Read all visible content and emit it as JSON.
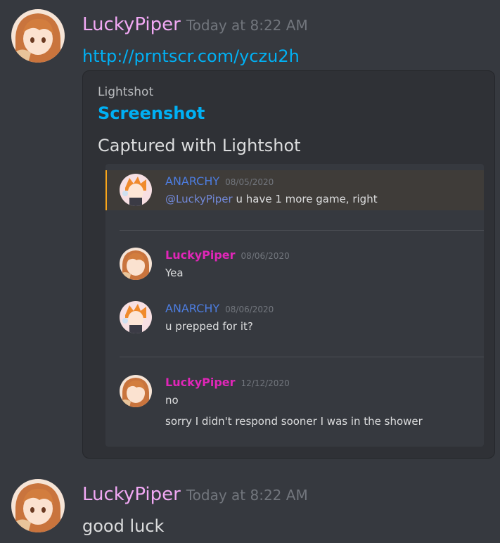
{
  "messages": [
    {
      "author": "LuckyPiper",
      "timestamp": "Today at 8:22 AM",
      "link": "http://prntscr.com/yczu2h",
      "embed": {
        "provider": "Lightshot",
        "title": "Screenshot",
        "description": "Captured with Lightshot",
        "screenshot": {
          "messages": [
            {
              "author": "ANARCHY",
              "date": "08/05/2020",
              "mention": "@LuckyPiper",
              "text": "u have 1 more game, right"
            },
            {
              "author": "LuckyPiper",
              "date": "08/06/2020",
              "text": "Yea"
            },
            {
              "author": "ANARCHY",
              "date": "08/06/2020",
              "text": "u prepped for it?"
            },
            {
              "author": "LuckyPiper",
              "date": "12/12/2020",
              "lines": [
                "no",
                "sorry I didn't respond sooner I was in the shower"
              ]
            }
          ]
        }
      }
    },
    {
      "author": "LuckyPiper",
      "timestamp": "Today at 8:22 AM",
      "text": "good luck"
    }
  ],
  "colors": {
    "background": "#36393f",
    "embed_background": "#2f3136",
    "username": "#f1a8f4",
    "link": "#00b0f4",
    "anarchy_role": "#4d7de0",
    "luckypiper_role": "#e026b8",
    "highlight_bar": "#faa61a"
  },
  "icons": [
    "user-avatar-luckypiper",
    "user-avatar-anarchy"
  ]
}
